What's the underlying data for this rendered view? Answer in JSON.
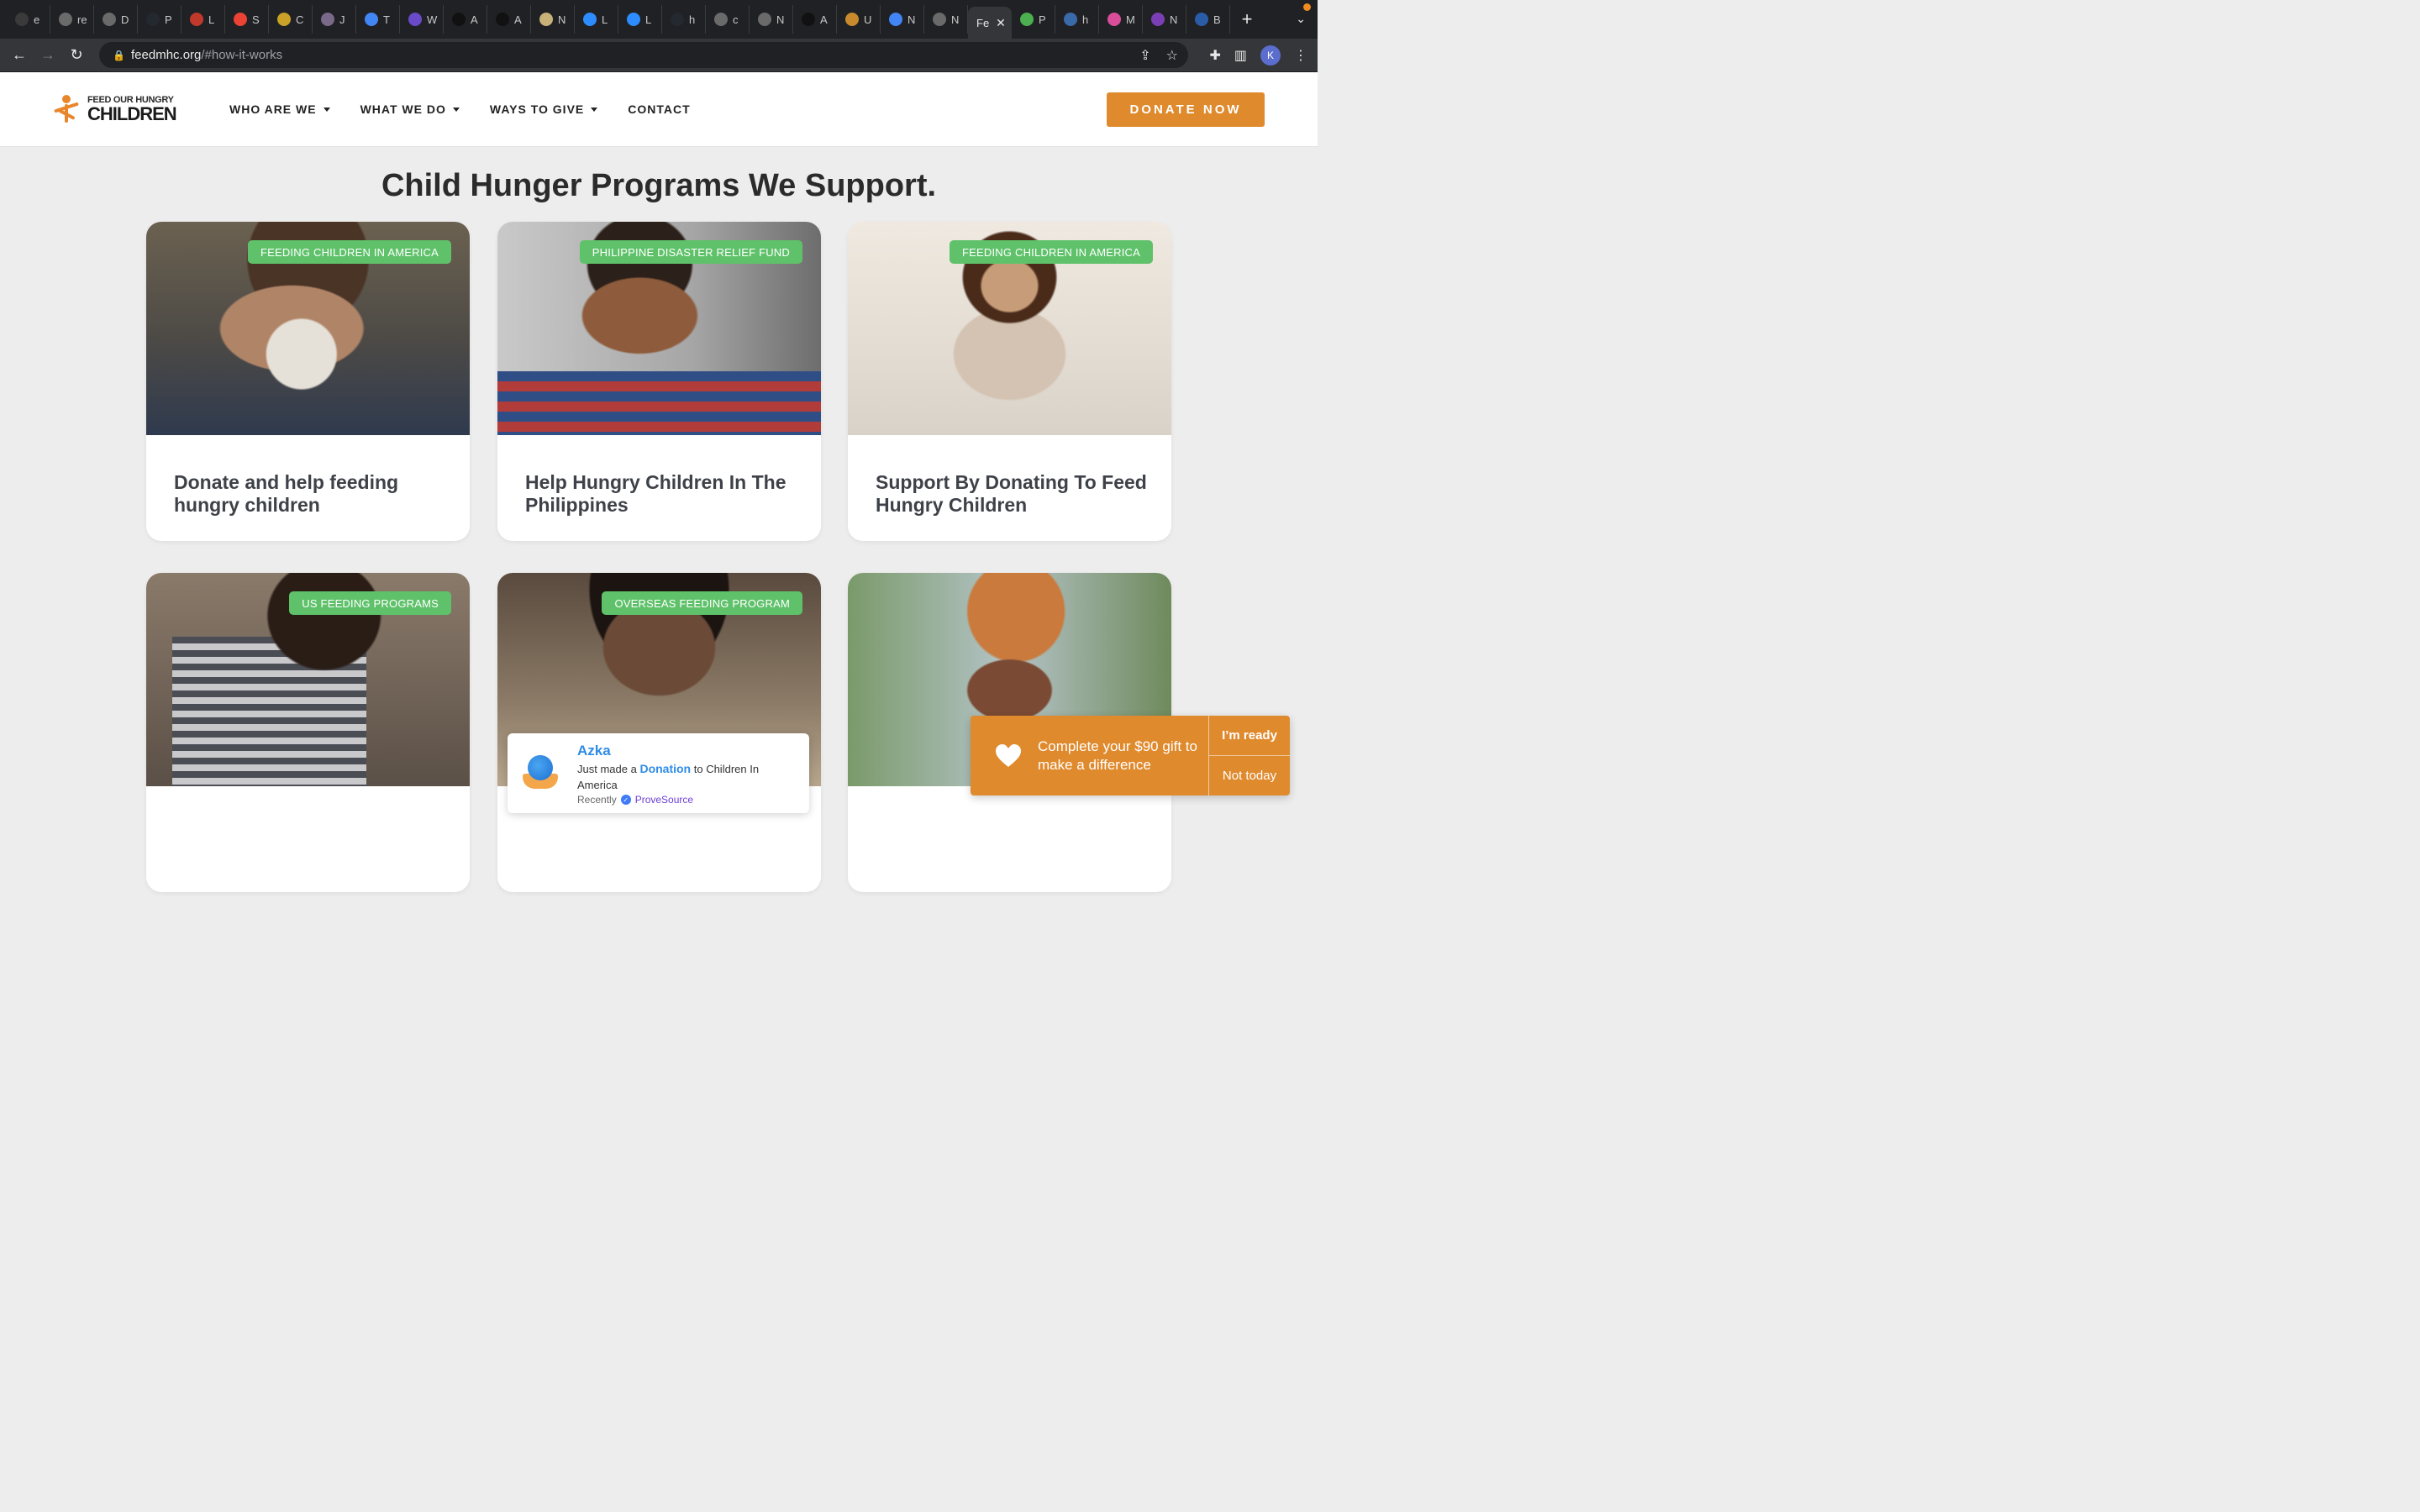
{
  "browser": {
    "tabs": [
      {
        "letter": "e",
        "color": "#3a3a3a",
        "icon": "logo-icon"
      },
      {
        "letter": "re",
        "color": "#6a6a6a",
        "icon": "globe-icon"
      },
      {
        "letter": "D",
        "color": "#6a6a6a",
        "icon": "globe-icon"
      },
      {
        "letter": "P",
        "color": "#24292f",
        "icon": "github-icon"
      },
      {
        "letter": "L",
        "color": "#c0392b",
        "icon": "badge-icon"
      },
      {
        "letter": "S",
        "color": "#ea4335",
        "icon": "gmail-icon"
      },
      {
        "letter": "C",
        "color": "#c9a227",
        "icon": "miro-icon"
      },
      {
        "letter": "J",
        "color": "#7a6a8a",
        "icon": "app-icon"
      },
      {
        "letter": "T",
        "color": "#4285f4",
        "icon": "google-icon"
      },
      {
        "letter": "W",
        "color": "#6a4ac9",
        "icon": "list-icon"
      },
      {
        "letter": "A",
        "color": "#111111",
        "icon": "amazon-icon"
      },
      {
        "letter": "A",
        "color": "#111111",
        "icon": "amazon-icon"
      },
      {
        "letter": "N",
        "color": "#c9b27a",
        "icon": "goodreads-icon"
      },
      {
        "letter": "L",
        "color": "#2d8cff",
        "icon": "zoom-icon"
      },
      {
        "letter": "L",
        "color": "#2d8cff",
        "icon": "zoom-icon"
      },
      {
        "letter": "h",
        "color": "#24292f",
        "icon": "github-icon"
      },
      {
        "letter": "c",
        "color": "#6a6a6a",
        "icon": "globe-icon"
      },
      {
        "letter": "N",
        "color": "#6a6a6a",
        "icon": "openai-icon"
      },
      {
        "letter": "A",
        "color": "#111111",
        "icon": "amazon-icon"
      },
      {
        "letter": "U",
        "color": "#c98a2e",
        "icon": "wheat-icon"
      },
      {
        "letter": "N",
        "color": "#4285f4",
        "icon": "docs-icon"
      },
      {
        "letter": "N",
        "color": "#6a6a6a",
        "icon": "openai-icon"
      }
    ],
    "active_tab": {
      "label": "Fe"
    },
    "tabs_after": [
      {
        "letter": "P",
        "color": "#4caf50",
        "icon": "apple-icon"
      },
      {
        "letter": "h",
        "color": "#3a6aa8",
        "icon": "frac-icon"
      },
      {
        "letter": "M",
        "color": "#d94e9a",
        "icon": "ring-icon"
      },
      {
        "letter": "N",
        "color": "#7b3fb5",
        "icon": "flower-icon"
      },
      {
        "letter": "B",
        "color": "#2a5ca8",
        "icon": "cdc-icon"
      }
    ],
    "url": {
      "domain": "feedmhc.org",
      "path": "/#how-it-works"
    },
    "profile_initial": "K",
    "recording_color": "#f28b20"
  },
  "site": {
    "logo": {
      "line1": "FEED OUR HUNGRY",
      "line2": "CHILDREN",
      "color": "#e8862c"
    },
    "nav": [
      {
        "label": "WHO ARE WE",
        "dropdown": true
      },
      {
        "label": "WHAT WE DO",
        "dropdown": true
      },
      {
        "label": "WAYS TO GIVE",
        "dropdown": true
      },
      {
        "label": "CONTACT",
        "dropdown": false
      }
    ],
    "donate_label": "DONATE NOW",
    "accent": "#e08a2e",
    "badge_color": "#5fc26a"
  },
  "main": {
    "title": "Child Hunger Programs We Support.",
    "cards": [
      {
        "badge": "FEEDING CHILDREN IN AMERICA",
        "title": "Donate and help feeding hungry children"
      },
      {
        "badge": "PHILIPPINE DISASTER RELIEF FUND",
        "title": "Help Hungry Children In The Philippines"
      },
      {
        "badge": "FEEDING CHILDREN IN AMERICA",
        "title": "Support By Donating To Feed Hungry Children"
      },
      {
        "badge": "US FEEDING PROGRAMS",
        "title": ""
      },
      {
        "badge": "OVERSEAS FEEDING PROGRAM",
        "title": ""
      },
      {
        "badge": "",
        "title": ""
      }
    ]
  },
  "proof_popup": {
    "name": "Azka",
    "prefix": "Just made a",
    "highlight": "Donation",
    "suffix": "to Children In America",
    "time": "Recently",
    "brand": "ProveSource"
  },
  "gift_nudge": {
    "message": "Complete your $90 gift to make a difference",
    "accept": "I’m ready",
    "decline": "Not today"
  }
}
